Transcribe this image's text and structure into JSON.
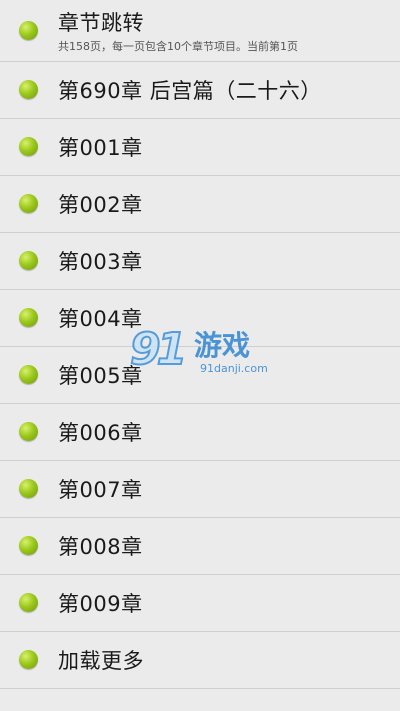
{
  "header": {
    "title": "章节跳转",
    "subtitle": "共158页，每一页包含10个章节项目。当前第1页"
  },
  "chapters": [
    {
      "label": "第690章 后宫篇（二十六）"
    },
    {
      "label": "第001章"
    },
    {
      "label": "第002章"
    },
    {
      "label": "第003章"
    },
    {
      "label": "第004章"
    },
    {
      "label": "第005章"
    },
    {
      "label": "第006章"
    },
    {
      "label": "第007章"
    },
    {
      "label": "第008章"
    },
    {
      "label": "第009章"
    }
  ],
  "load_more": {
    "label": "加载更多"
  },
  "watermark": {
    "logo_number": "91",
    "logo_name": "游戏",
    "url": "91danji.com"
  },
  "colors": {
    "background": "#ebebeb",
    "divider": "#cfcfcf",
    "bullet": "#9bc81c",
    "watermark_blue": "#2f86d2"
  },
  "icons": {
    "bullet": "green-dot-icon"
  }
}
